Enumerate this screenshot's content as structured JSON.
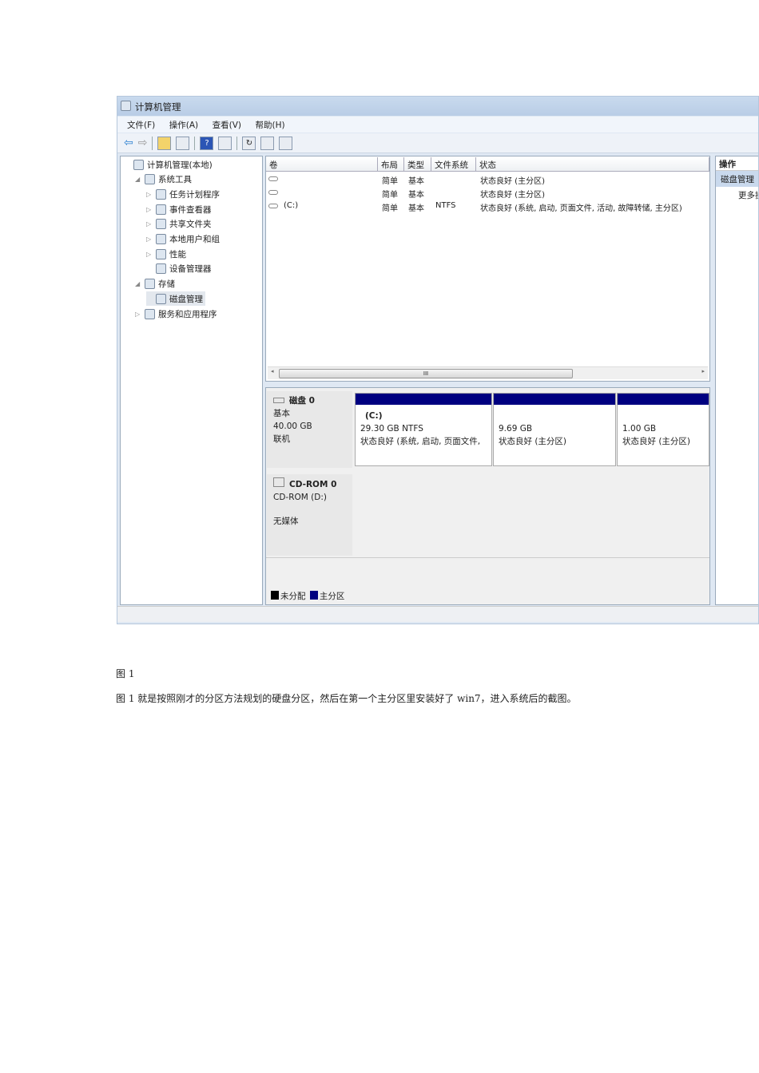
{
  "window": {
    "title": "计算机管理",
    "menu": [
      "文件(F)",
      "操作(A)",
      "查看(V)",
      "帮助(H)"
    ]
  },
  "tree": [
    {
      "label": "计算机管理(本地)",
      "level": 0,
      "arrow": ""
    },
    {
      "label": "系统工具",
      "level": 1,
      "arrow": "◢"
    },
    {
      "label": "任务计划程序",
      "level": 2,
      "arrow": "▷"
    },
    {
      "label": "事件查看器",
      "level": 2,
      "arrow": "▷"
    },
    {
      "label": "共享文件夹",
      "level": 2,
      "arrow": "▷"
    },
    {
      "label": "本地用户和组",
      "level": 2,
      "arrow": "▷"
    },
    {
      "label": "性能",
      "level": 2,
      "arrow": "▷"
    },
    {
      "label": "设备管理器",
      "level": 2,
      "arrow": ""
    },
    {
      "label": "存储",
      "level": 1,
      "arrow": "◢"
    },
    {
      "label": "磁盘管理",
      "level": 2,
      "arrow": "",
      "selected": true
    },
    {
      "label": "服务和应用程序",
      "level": 1,
      "arrow": "▷"
    }
  ],
  "list": {
    "headers": [
      "卷",
      "布局",
      "类型",
      "文件系统",
      "状态"
    ],
    "rows": [
      {
        "vol": "",
        "layout": "简单",
        "type": "基本",
        "fs": "",
        "status": "状态良好 (主分区)"
      },
      {
        "vol": "",
        "layout": "简单",
        "type": "基本",
        "fs": "",
        "status": "状态良好 (主分区)"
      },
      {
        "vol": "(C:)",
        "layout": "简单",
        "type": "基本",
        "fs": "NTFS",
        "status": "状态良好 (系统, 启动, 页面文件, 活动, 故障转储, 主分区)"
      }
    ],
    "scroll_grip": "III"
  },
  "disk0": {
    "name": "磁盘 0",
    "type": "基本",
    "size": "40.00 GB",
    "state": "联机",
    "partitions": [
      {
        "label": "(C:)",
        "size": "29.30 GB NTFS",
        "status": "状态良好 (系统, 启动, 页面文件,"
      },
      {
        "label": "",
        "size": "9.69 GB",
        "status": "状态良好 (主分区)"
      },
      {
        "label": "",
        "size": "1.00 GB",
        "status": "状态良好 (主分区)"
      }
    ]
  },
  "cdrom": {
    "name": "CD-ROM 0",
    "drive": "CD-ROM (D:)",
    "media": "无媒体"
  },
  "legend": [
    {
      "label": "未分配",
      "color": "#000000"
    },
    {
      "label": "主分区",
      "color": "#000080"
    }
  ],
  "actions": {
    "title": "操作",
    "section": "磁盘管理",
    "more": "更多操"
  },
  "doc": {
    "caption": "图 1",
    "paragraph": "图 1 就是按照刚才的分区方法规划的硬盘分区，然后在第一个主分区里安装好了 win7，进入系统后的截图。"
  }
}
